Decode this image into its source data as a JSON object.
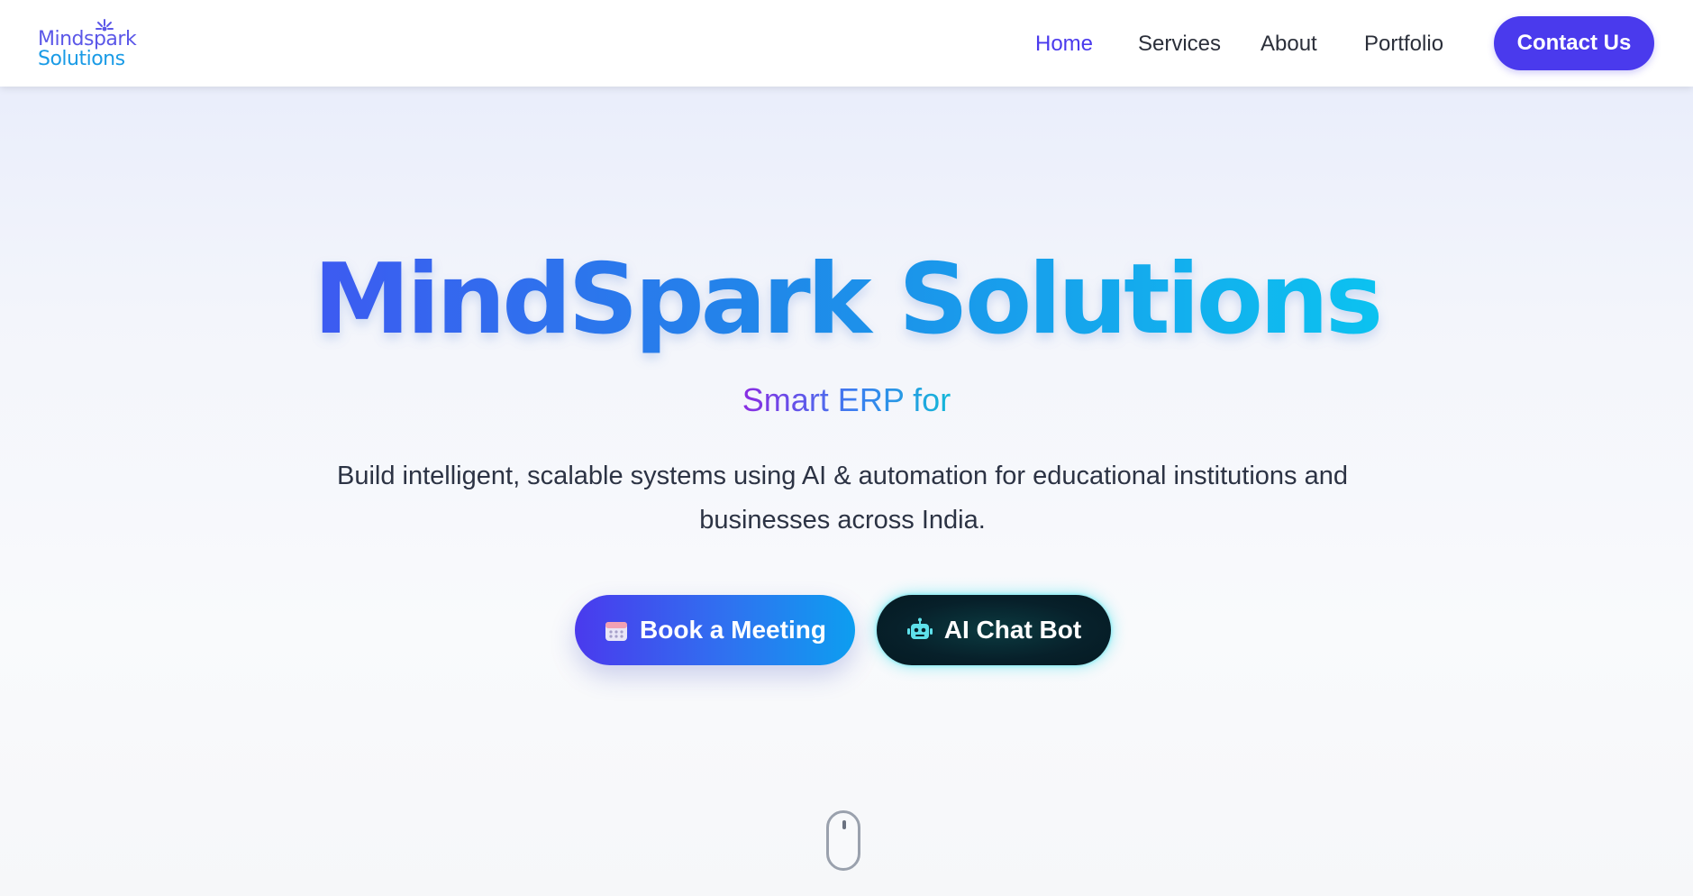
{
  "brand": {
    "logo_line1": "Mindspark",
    "logo_line2": "Solutions",
    "logo_icon": "spark-icon"
  },
  "nav": {
    "links": [
      {
        "label": "Home",
        "active": true
      },
      {
        "label": "Services",
        "active": false
      },
      {
        "label": "About",
        "active": false
      },
      {
        "label": "Portfolio",
        "active": false
      }
    ],
    "contact_label": "Contact Us"
  },
  "hero": {
    "title": "MindSpark Solutions",
    "subtitle": "Smart ERP for",
    "description": "Build intelligent, scalable systems using AI & automation for educational institutions and businesses across India.",
    "primary_button": {
      "label": "Book a Meeting",
      "icon": "calendar-icon"
    },
    "secondary_button": {
      "label": "AI Chat Bot",
      "icon": "robot-icon"
    }
  },
  "scroll_indicator": {
    "icon": "mouse-scroll-icon"
  },
  "colors": {
    "accent": "#4a3aed",
    "title_gradient_start": "#3d5af1",
    "title_gradient_end": "#0cc2f0",
    "chat_button_bg": "#07202a",
    "chat_glow": "#00dceb"
  }
}
